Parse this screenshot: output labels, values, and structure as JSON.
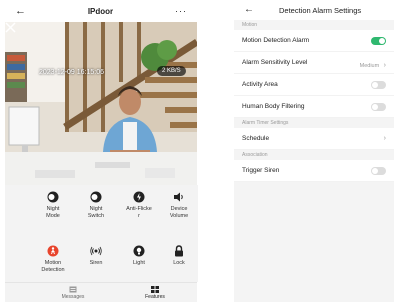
{
  "camera": {
    "title": "IPdoor",
    "back_icon": "back-arrow-icon",
    "more_icon": "more-dots-icon",
    "more_label": "···",
    "osd_datetime": "2023-12-09  16:15:06",
    "bitrate": "2 KB/S",
    "controls": [
      {
        "label": "Night\nMode",
        "icon": "moon-icon"
      },
      {
        "label": "Night\nSwitch",
        "icon": "moon-icon"
      },
      {
        "label": "Anti-Flicke\nr",
        "icon": "flash-icon"
      },
      {
        "label": "Device\nVolume",
        "icon": "speaker-icon"
      },
      {
        "label": "Motion\nDetection",
        "icon": "motion-person-icon",
        "color": "#e8442c"
      },
      {
        "label": "Siren",
        "icon": "siren-icon"
      },
      {
        "label": "Light",
        "icon": "bulb-icon"
      },
      {
        "label": "Lock",
        "icon": "lock-icon"
      }
    ],
    "nav": [
      {
        "label": "Messages",
        "icon": "message-icon"
      },
      {
        "label": "Features",
        "icon": "grid-icon",
        "active": true
      }
    ]
  },
  "settings": {
    "title": "Detection Alarm Settings",
    "back_icon": "back-arrow-icon",
    "sections": {
      "motion": "Motion",
      "timer": "Alarm Timer Settings",
      "association": "Association"
    },
    "rows": {
      "motion_detection_alarm": {
        "label": "Motion Detection Alarm",
        "on": true
      },
      "sensitivity": {
        "label": "Alarm Sensitivity Level",
        "value": "Medium"
      },
      "activity_area": {
        "label": "Activity Area",
        "on": false
      },
      "human_body": {
        "label": "Human Body Filtering",
        "on": false
      },
      "schedule": {
        "label": "Schedule"
      },
      "trigger_siren": {
        "label": "Trigger Siren",
        "on": false
      }
    },
    "accent": "#2fb86f"
  }
}
